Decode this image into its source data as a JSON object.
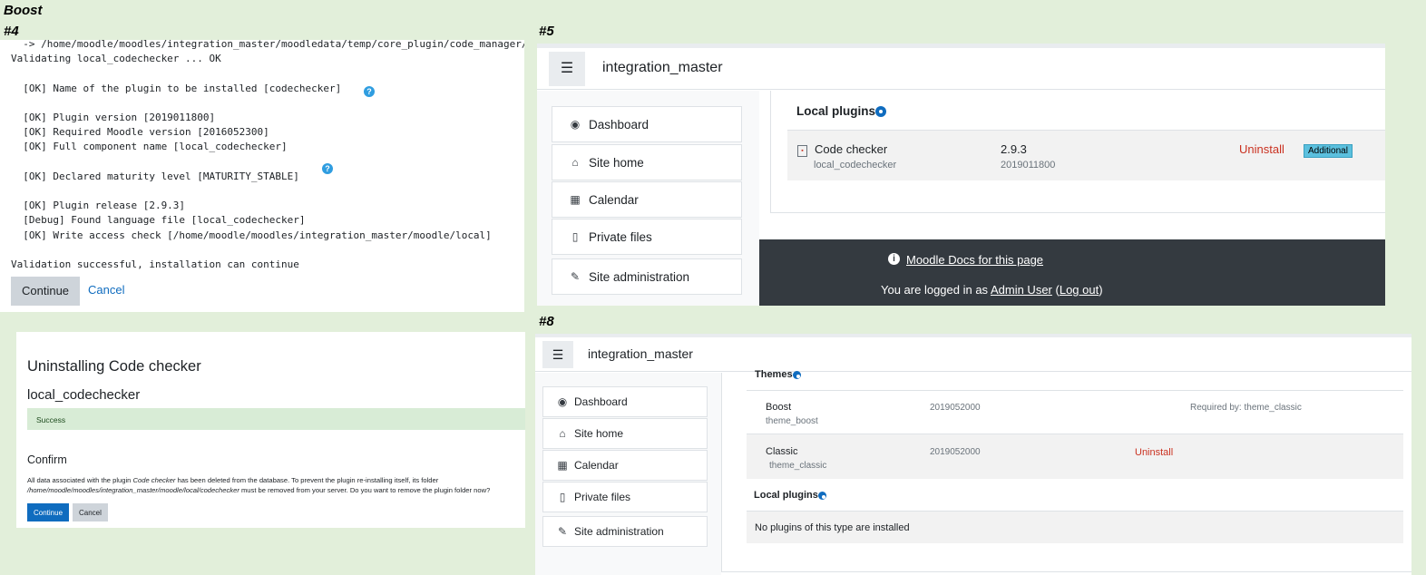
{
  "labels": {
    "theme": "Boost",
    "p4": "#4",
    "p5": "#5",
    "p8": "#8"
  },
  "panel4": {
    "log_lines": [
      "  -> /home/moodle/moodles/integration_master/moodledata/temp/core_plugin/code_manager/",
      "Validating local_codechecker ... OK",
      "",
      "  [OK] Name of the plugin to be installed [codechecker]",
      "",
      "  [OK] Plugin version [2019011800]",
      "  [OK] Required Moodle version [2016052300]",
      "  [OK] Full component name [local_codechecker]",
      "",
      "  [OK] Declared maturity level [MATURITY_STABLE]",
      "",
      "  [OK] Plugin release [2.9.3]",
      "  [Debug] Found language file [local_codechecker]",
      "  [OK] Write access check [/home/moodle/moodles/integration_master/moodle/local]",
      "",
      "Validation successful, installation can continue"
    ],
    "help_glyph": "?",
    "continue_label": "Continue",
    "cancel_label": "Cancel"
  },
  "uninstall": {
    "title": "Uninstalling Code checker",
    "component": "local_codechecker",
    "success": "Success",
    "confirm_heading": "Confirm",
    "msg_1": "All data associated with the plugin ",
    "msg_plugin": "Code checker",
    "msg_2": " has been deleted from the database. To prevent the plugin re-installing itself, its folder",
    "msg_path": "/home/moodle/moodles/integration_master/moodle/local/codechecker",
    "msg_3": " must be removed from your server. Do you want to remove the plugin folder now?",
    "continue_label": "Continue",
    "cancel_label": "Cancel"
  },
  "panel5": {
    "site_name": "integration_master",
    "nav": [
      "Dashboard",
      "Site home",
      "Calendar",
      "Private files",
      "Site administration"
    ],
    "section": "Local plugins",
    "plugin_name": "Code checker",
    "plugin_component": "local_codechecker",
    "release": "2.9.3",
    "version": "2019011800",
    "uninstall": "Uninstall",
    "badge": "Additional",
    "docs_link": "Moodle Docs for this page",
    "logged_in_prefix": "You are logged in as ",
    "user": "Admin User",
    "logout": "Log out"
  },
  "panel8": {
    "site_name": "integration_master",
    "nav": [
      "Dashboard",
      "Site home",
      "Calendar",
      "Private files",
      "Site administration"
    ],
    "themes_heading": "Themes",
    "themes": [
      {
        "name": "Boost",
        "component": "theme_boost",
        "version": "2019052000",
        "note": "Required by: theme_classic"
      },
      {
        "name": "Classic",
        "component": "theme_classic",
        "version": "2019052000",
        "action": "Uninstall"
      }
    ],
    "local_heading": "Local plugins",
    "no_plugins": "No plugins of this type are installed"
  },
  "colors": {
    "primary": "#0f6cbf",
    "danger": "#ca3120",
    "badge": "#5bc0de",
    "footer": "#343a40",
    "success_bg": "#d8ecd6"
  }
}
